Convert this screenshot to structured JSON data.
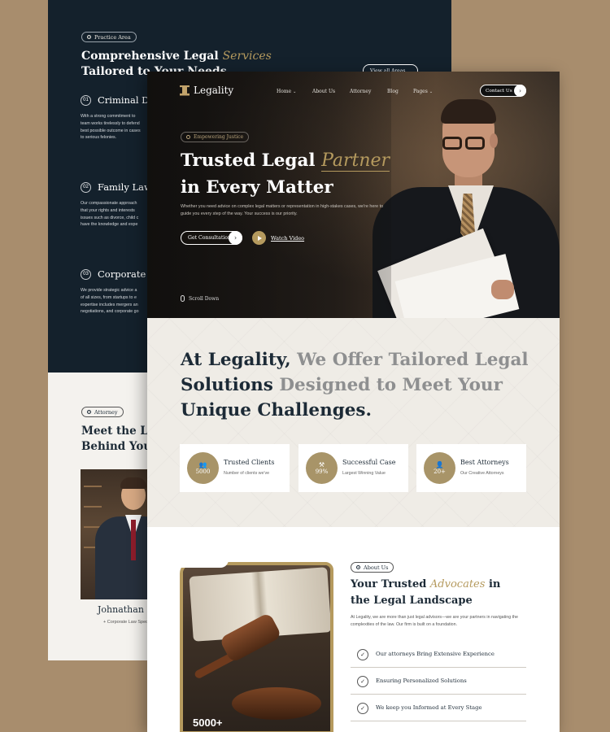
{
  "back_page": {
    "practice_area": {
      "pill": "Practice Area",
      "title_line1_prefix": "Comprehensive Legal",
      "title_line1_script": "Services",
      "title_line2": "Tailored to Your Needs",
      "view_all": "View all Areas",
      "services": [
        {
          "num": "01",
          "title": "Criminal Defense",
          "desc": [
            "With a strong commitment to",
            "team works tirelessly to defend",
            "best possible outcome in cases",
            "to serious felonies."
          ]
        },
        {
          "num": "02",
          "title": "Family Law",
          "desc": [
            "Our compassionate approach",
            "that your rights and interests",
            "issues such as divorce, child c",
            "have the knowledge and expe"
          ]
        },
        {
          "num": "03",
          "title": "Corporate Law",
          "desc": [
            "We provide strategic advice a",
            "of all sizes, from startups to e",
            "expertise includes mergers an",
            "negotiations, and corporate go"
          ]
        }
      ]
    },
    "attorney": {
      "pill": "Attorney",
      "title_line1": "Meet the Legal Experts",
      "title_line2": "Behind Your Success",
      "name": "Johnathan Doe",
      "role": "Corporate Law Specialist"
    }
  },
  "front_page": {
    "nav": {
      "logo": "Legality",
      "items": [
        {
          "label": "Home",
          "dropdown": true
        },
        {
          "label": "About Us",
          "dropdown": false
        },
        {
          "label": "Attorney",
          "dropdown": false
        },
        {
          "label": "Blog",
          "dropdown": false
        },
        {
          "label": "Pages",
          "dropdown": true
        }
      ],
      "contact": "Contact Us"
    },
    "hero": {
      "eyebrow": "Empowering Justice",
      "title_prefix": "Trusted Legal",
      "title_script": "Partner",
      "title_line2": "in Every Matter",
      "desc": "Whether you need advice on complex legal matters or representation in high-stakes cases, we're here to guide you every step of the way. Your success is our priority.",
      "cta": "Get Consultation",
      "watch": "Watch Video",
      "scroll": "Scroll Down"
    },
    "tailored": {
      "t1_dark": "At Legality,",
      "t1_grey": " We Offer Tailored Legal",
      "t2_dark": "Solutions",
      "t2_grey": " Designed to Meet Your",
      "t3_dark": "Unique Challenges.",
      "stats": [
        {
          "icon": "users-icon",
          "value": "5000",
          "title": "Trusted Clients",
          "sub": "Number of clients we've"
        },
        {
          "icon": "gavel-icon",
          "value": "99%",
          "title": "Successful Case",
          "sub": "Largest Winning Value"
        },
        {
          "icon": "user-icon",
          "value": "20+",
          "title": "Best Attorneys",
          "sub": "Our Creative Attorneys"
        }
      ]
    },
    "about": {
      "pill": "About Us",
      "title_prefix": "Your Trusted",
      "title_script": "Advocates",
      "title_suffix": "in",
      "title_line2": "the Legal Landscape",
      "desc": "At Legality, we are more than just legal advisors—we are your partners in navigating the complexities of the law. Our firm is built on a foundation.",
      "image_count": "5000+",
      "features": [
        "Our attorneys Bring Extensive Experience",
        "Ensuring Personalized Solutions",
        "We keep you Informed at Every Stage"
      ]
    }
  }
}
